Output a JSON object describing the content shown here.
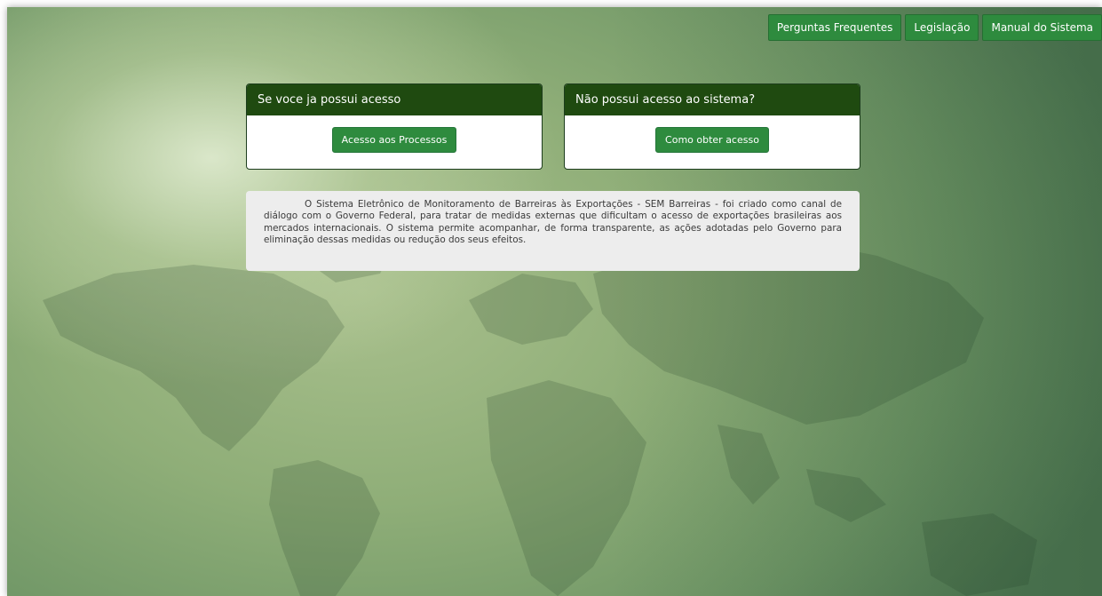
{
  "nav": {
    "faq_label": "Perguntas Frequentes",
    "legislation_label": "Legislação",
    "manual_label": "Manual do Sistema"
  },
  "panels": {
    "has_access": {
      "title": "Se voce ja possui acesso",
      "button_label": "Acesso aos Processos"
    },
    "no_access": {
      "title": "Não possui acesso ao sistema?",
      "button_label": "Como obter acesso"
    }
  },
  "description": {
    "text": "O Sistema Eletrônico de Monitoramento de Barreiras às Exportações - SEM Barreiras - foi criado como canal de diálogo com o Governo Federal, para tratar de medidas externas que dificultam o acesso de exportações brasileiras aos mercados internacionais. O sistema permite acompanhar, de forma transparente, as ações adotadas pelo Governo para eliminação dessas medidas ou redução dos seus efeitos."
  },
  "colors": {
    "header_dark_green": "#1f4a10",
    "button_green": "#2e8b3e",
    "background_green": "#8fae78"
  }
}
